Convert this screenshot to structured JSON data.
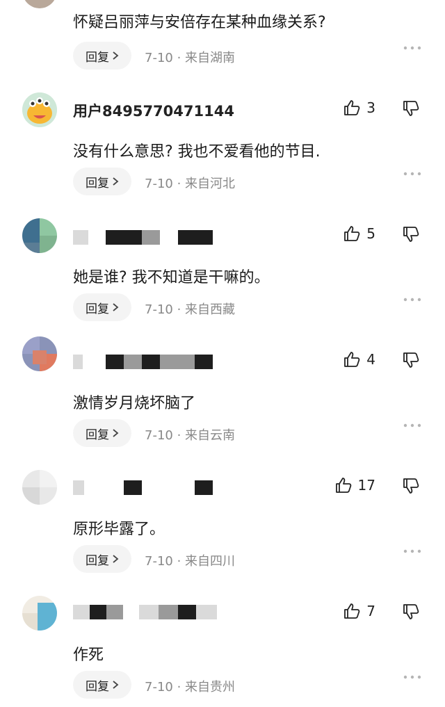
{
  "comments": [
    {
      "username": "",
      "text": "怀疑吕丽萍与安倍存在某种血缘关系?",
      "reply_label": "回复",
      "date": "7-10",
      "location": "来自湖南",
      "likes": "",
      "avatar": "partial-avatar"
    },
    {
      "username": "用户8495770471144",
      "text": "没有什么意思? 我也不爱看他的节目.",
      "reply_label": "回复",
      "date": "7-10",
      "location": "来自河北",
      "likes": "3",
      "avatar": "alien-cartoon-avatar"
    },
    {
      "username": "",
      "text": "她是谁? 我不知道是干嘛的。",
      "reply_label": "回复",
      "date": "7-10",
      "location": "来自西藏",
      "likes": "5",
      "avatar": "pixelated-avatar"
    },
    {
      "username": "",
      "text": "激情岁月烧坏脑了",
      "reply_label": "回复",
      "date": "7-10",
      "location": "来自云南",
      "likes": "4",
      "avatar": "pixelated-avatar"
    },
    {
      "username": "",
      "text": "原形毕露了。",
      "reply_label": "回复",
      "date": "7-10",
      "location": "来自四川",
      "likes": "17",
      "avatar": "pixelated-avatar"
    },
    {
      "username": "",
      "text": "作死",
      "reply_label": "回复",
      "date": "7-10",
      "location": "来自贵州",
      "likes": "7",
      "avatar": "pixelated-avatar"
    }
  ],
  "icons": {
    "like": "thumbs-up-icon",
    "dislike": "thumbs-down-icon",
    "more": "more-dots-icon",
    "chevron": "chevron-right-icon"
  },
  "colors": {
    "meta_text": "#888888",
    "reply_bg": "#f4f4f4",
    "alien_bg": "#f7b733"
  }
}
